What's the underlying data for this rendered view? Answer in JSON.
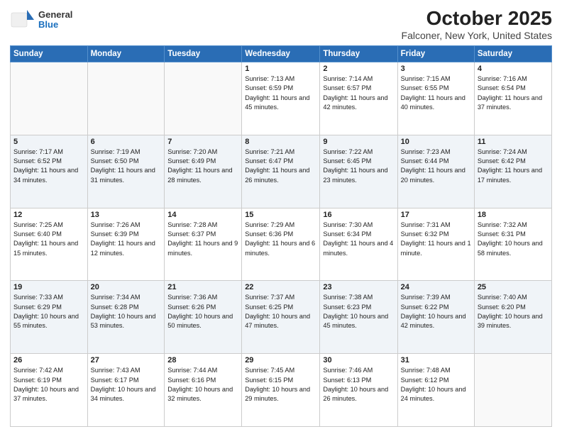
{
  "header": {
    "logo_general": "General",
    "logo_blue": "Blue",
    "month_year": "October 2025",
    "location": "Falconer, New York, United States"
  },
  "weekdays": [
    "Sunday",
    "Monday",
    "Tuesday",
    "Wednesday",
    "Thursday",
    "Friday",
    "Saturday"
  ],
  "weeks": [
    [
      {
        "day": "",
        "sunrise": "",
        "sunset": "",
        "daylight": ""
      },
      {
        "day": "",
        "sunrise": "",
        "sunset": "",
        "daylight": ""
      },
      {
        "day": "",
        "sunrise": "",
        "sunset": "",
        "daylight": ""
      },
      {
        "day": "1",
        "sunrise": "Sunrise: 7:13 AM",
        "sunset": "Sunset: 6:59 PM",
        "daylight": "Daylight: 11 hours and 45 minutes."
      },
      {
        "day": "2",
        "sunrise": "Sunrise: 7:14 AM",
        "sunset": "Sunset: 6:57 PM",
        "daylight": "Daylight: 11 hours and 42 minutes."
      },
      {
        "day": "3",
        "sunrise": "Sunrise: 7:15 AM",
        "sunset": "Sunset: 6:55 PM",
        "daylight": "Daylight: 11 hours and 40 minutes."
      },
      {
        "day": "4",
        "sunrise": "Sunrise: 7:16 AM",
        "sunset": "Sunset: 6:54 PM",
        "daylight": "Daylight: 11 hours and 37 minutes."
      }
    ],
    [
      {
        "day": "5",
        "sunrise": "Sunrise: 7:17 AM",
        "sunset": "Sunset: 6:52 PM",
        "daylight": "Daylight: 11 hours and 34 minutes."
      },
      {
        "day": "6",
        "sunrise": "Sunrise: 7:19 AM",
        "sunset": "Sunset: 6:50 PM",
        "daylight": "Daylight: 11 hours and 31 minutes."
      },
      {
        "day": "7",
        "sunrise": "Sunrise: 7:20 AM",
        "sunset": "Sunset: 6:49 PM",
        "daylight": "Daylight: 11 hours and 28 minutes."
      },
      {
        "day": "8",
        "sunrise": "Sunrise: 7:21 AM",
        "sunset": "Sunset: 6:47 PM",
        "daylight": "Daylight: 11 hours and 26 minutes."
      },
      {
        "day": "9",
        "sunrise": "Sunrise: 7:22 AM",
        "sunset": "Sunset: 6:45 PM",
        "daylight": "Daylight: 11 hours and 23 minutes."
      },
      {
        "day": "10",
        "sunrise": "Sunrise: 7:23 AM",
        "sunset": "Sunset: 6:44 PM",
        "daylight": "Daylight: 11 hours and 20 minutes."
      },
      {
        "day": "11",
        "sunrise": "Sunrise: 7:24 AM",
        "sunset": "Sunset: 6:42 PM",
        "daylight": "Daylight: 11 hours and 17 minutes."
      }
    ],
    [
      {
        "day": "12",
        "sunrise": "Sunrise: 7:25 AM",
        "sunset": "Sunset: 6:40 PM",
        "daylight": "Daylight: 11 hours and 15 minutes."
      },
      {
        "day": "13",
        "sunrise": "Sunrise: 7:26 AM",
        "sunset": "Sunset: 6:39 PM",
        "daylight": "Daylight: 11 hours and 12 minutes."
      },
      {
        "day": "14",
        "sunrise": "Sunrise: 7:28 AM",
        "sunset": "Sunset: 6:37 PM",
        "daylight": "Daylight: 11 hours and 9 minutes."
      },
      {
        "day": "15",
        "sunrise": "Sunrise: 7:29 AM",
        "sunset": "Sunset: 6:36 PM",
        "daylight": "Daylight: 11 hours and 6 minutes."
      },
      {
        "day": "16",
        "sunrise": "Sunrise: 7:30 AM",
        "sunset": "Sunset: 6:34 PM",
        "daylight": "Daylight: 11 hours and 4 minutes."
      },
      {
        "day": "17",
        "sunrise": "Sunrise: 7:31 AM",
        "sunset": "Sunset: 6:32 PM",
        "daylight": "Daylight: 11 hours and 1 minute."
      },
      {
        "day": "18",
        "sunrise": "Sunrise: 7:32 AM",
        "sunset": "Sunset: 6:31 PM",
        "daylight": "Daylight: 10 hours and 58 minutes."
      }
    ],
    [
      {
        "day": "19",
        "sunrise": "Sunrise: 7:33 AM",
        "sunset": "Sunset: 6:29 PM",
        "daylight": "Daylight: 10 hours and 55 minutes."
      },
      {
        "day": "20",
        "sunrise": "Sunrise: 7:34 AM",
        "sunset": "Sunset: 6:28 PM",
        "daylight": "Daylight: 10 hours and 53 minutes."
      },
      {
        "day": "21",
        "sunrise": "Sunrise: 7:36 AM",
        "sunset": "Sunset: 6:26 PM",
        "daylight": "Daylight: 10 hours and 50 minutes."
      },
      {
        "day": "22",
        "sunrise": "Sunrise: 7:37 AM",
        "sunset": "Sunset: 6:25 PM",
        "daylight": "Daylight: 10 hours and 47 minutes."
      },
      {
        "day": "23",
        "sunrise": "Sunrise: 7:38 AM",
        "sunset": "Sunset: 6:23 PM",
        "daylight": "Daylight: 10 hours and 45 minutes."
      },
      {
        "day": "24",
        "sunrise": "Sunrise: 7:39 AM",
        "sunset": "Sunset: 6:22 PM",
        "daylight": "Daylight: 10 hours and 42 minutes."
      },
      {
        "day": "25",
        "sunrise": "Sunrise: 7:40 AM",
        "sunset": "Sunset: 6:20 PM",
        "daylight": "Daylight: 10 hours and 39 minutes."
      }
    ],
    [
      {
        "day": "26",
        "sunrise": "Sunrise: 7:42 AM",
        "sunset": "Sunset: 6:19 PM",
        "daylight": "Daylight: 10 hours and 37 minutes."
      },
      {
        "day": "27",
        "sunrise": "Sunrise: 7:43 AM",
        "sunset": "Sunset: 6:17 PM",
        "daylight": "Daylight: 10 hours and 34 minutes."
      },
      {
        "day": "28",
        "sunrise": "Sunrise: 7:44 AM",
        "sunset": "Sunset: 6:16 PM",
        "daylight": "Daylight: 10 hours and 32 minutes."
      },
      {
        "day": "29",
        "sunrise": "Sunrise: 7:45 AM",
        "sunset": "Sunset: 6:15 PM",
        "daylight": "Daylight: 10 hours and 29 minutes."
      },
      {
        "day": "30",
        "sunrise": "Sunrise: 7:46 AM",
        "sunset": "Sunset: 6:13 PM",
        "daylight": "Daylight: 10 hours and 26 minutes."
      },
      {
        "day": "31",
        "sunrise": "Sunrise: 7:48 AM",
        "sunset": "Sunset: 6:12 PM",
        "daylight": "Daylight: 10 hours and 24 minutes."
      },
      {
        "day": "",
        "sunrise": "",
        "sunset": "",
        "daylight": ""
      }
    ]
  ]
}
